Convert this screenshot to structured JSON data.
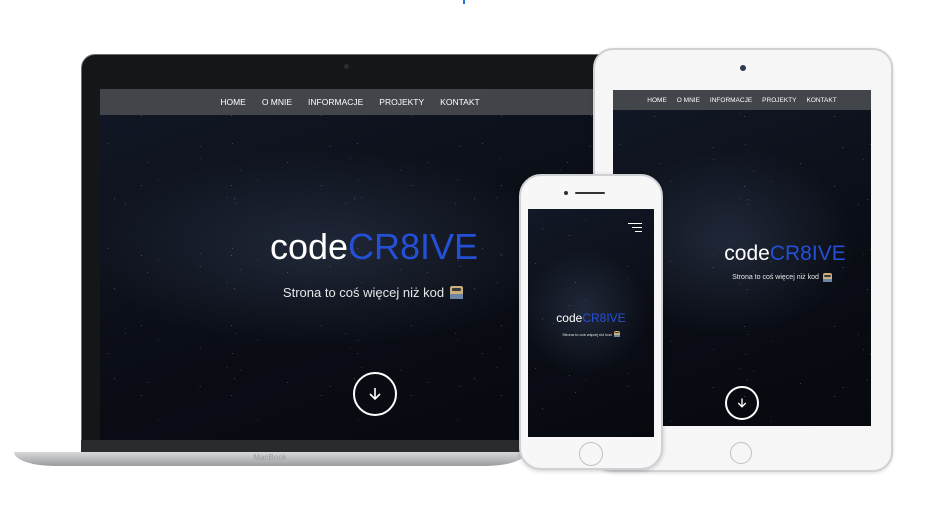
{
  "site": {
    "nav_items": [
      "HOME",
      "O MNIE",
      "INFORMACJE",
      "PROJEKTY",
      "KONTAKT"
    ],
    "brand_prefix": "code",
    "brand_accent": "CR8IVE",
    "tagline": "Strona to coś więcej niż kod",
    "scroll_icon": "arrow-down-icon",
    "accent_color": "#2450d8"
  },
  "devices": {
    "laptop_label": "MacBook"
  }
}
